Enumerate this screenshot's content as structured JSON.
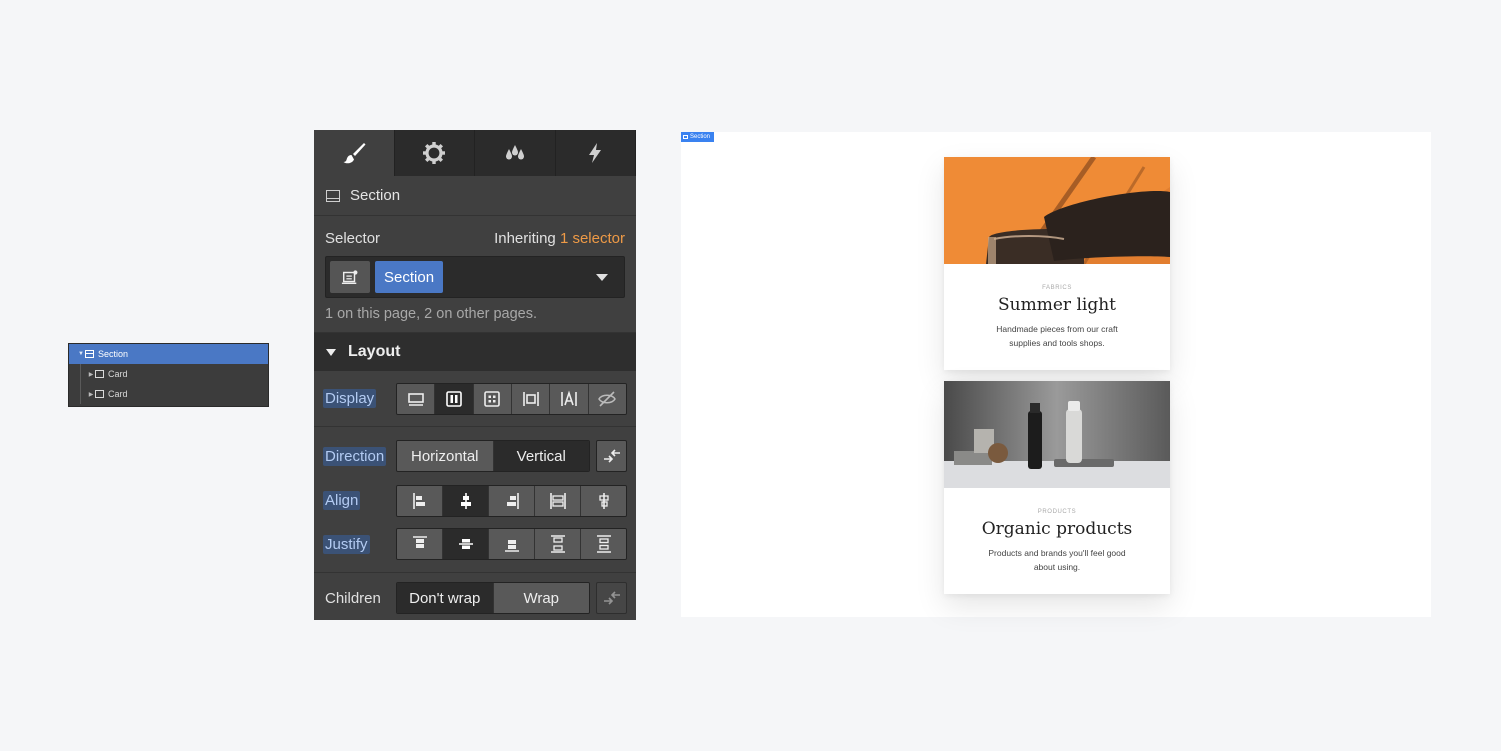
{
  "navigator": {
    "items": [
      {
        "label": "Section",
        "selected": true
      },
      {
        "label": "Card"
      },
      {
        "label": "Card"
      }
    ]
  },
  "panel": {
    "tabs": [
      "style-tab",
      "settings-tab",
      "style-manager-tab",
      "interactions-tab"
    ],
    "element_name": "Section",
    "selector": {
      "label": "Selector",
      "inheriting_prefix": "Inheriting",
      "inheriting_count": "1 selector",
      "chip": "Section",
      "note": "1 on this page, 2 on other pages."
    },
    "layout": {
      "header": "Layout",
      "display_label": "Display",
      "direction_label": "Direction",
      "direction_options": [
        "Horizontal",
        "Vertical"
      ],
      "align_label": "Align",
      "justify_label": "Justify",
      "children_label": "Children",
      "children_options": [
        "Don't wrap",
        "Wrap"
      ]
    }
  },
  "canvas": {
    "badge": "Section",
    "cards": [
      {
        "eyebrow": "FABRICS",
        "title": "Summer light",
        "desc": "Handmade pieces from our craft supplies and tools shops."
      },
      {
        "eyebrow": "PRODUCTS",
        "title": "Organic products",
        "desc": "Products and brands you'll feel good about using."
      }
    ]
  },
  "colors": {
    "accent_blue": "#4a78c5",
    "accent_orange": "#ee9a46",
    "panel_bg": "#404040"
  }
}
